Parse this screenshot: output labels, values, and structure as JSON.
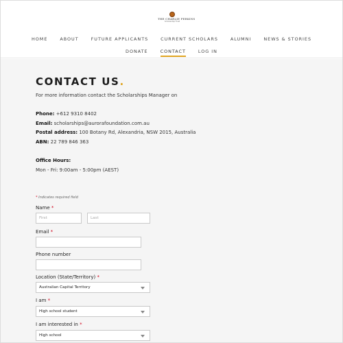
{
  "logo": {
    "name": "THE CHARLIE PERKINS",
    "tagline": "Scholarship Trust"
  },
  "nav": {
    "row1": [
      "HOME",
      "ABOUT",
      "FUTURE APPLICANTS",
      "CURRENT SCHOLARS",
      "ALUMNI",
      "NEWS & STORIES"
    ],
    "row2": [
      "DONATE",
      "CONTACT",
      "LOG IN"
    ],
    "active": "CONTACT"
  },
  "contact": {
    "title": "CONTACT US",
    "title_dot": ".",
    "intro": "For more information contact the Scholarships Manager on",
    "phone_label": "Phone:",
    "phone_value": "+612 9310 8402",
    "email_label": "Email:",
    "email_value": "scholarships@aurorafoundation.com.au",
    "address_label": "Postal address:",
    "address_value": "100 Botany Rd, Alexandria, NSW 2015, Australia",
    "abn_label": "ABN:",
    "abn_value": "22 789 846 363",
    "hours_label": "Office Hours:",
    "hours_value": "Mon - Fri: 9:00am - 5:00pm (AEST)"
  },
  "form": {
    "required_note_star": "*",
    "required_note": "Indicates required field",
    "name_label": "Name",
    "first_placeholder": "First",
    "last_placeholder": "Last",
    "email_label": "Email",
    "phone_label": "Phone number",
    "location_label": "Location (State/Territory)",
    "location_value": "Australian Capital Territory",
    "iam_label": "I am",
    "iam_value": "High school student",
    "interest_label": "I am interested in",
    "interest_value": "High school",
    "required_star": "*"
  },
  "colors": {
    "accent": "#e0a31e",
    "required": "#d0021b",
    "background": "#f5f5f5"
  }
}
